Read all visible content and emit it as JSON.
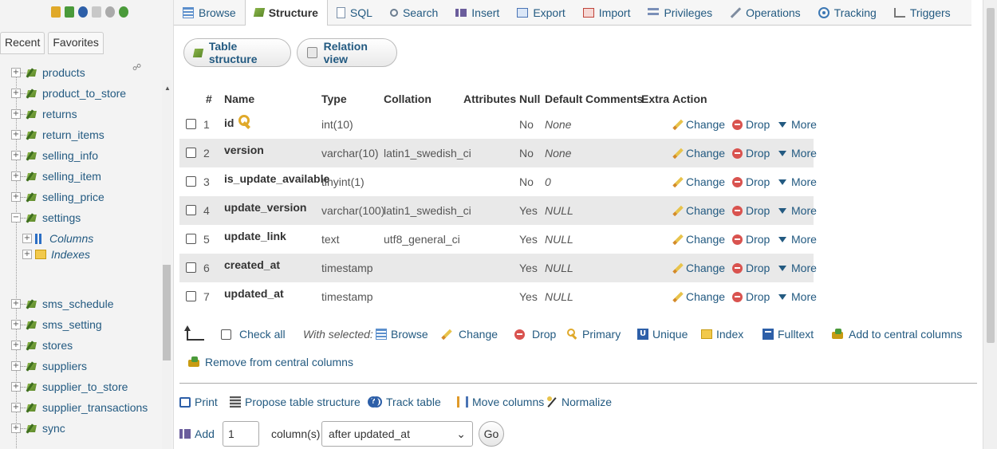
{
  "navigation": {
    "tabs": [
      "Recent",
      "Favorites"
    ],
    "tables_above": [
      {
        "label": "products"
      },
      {
        "label": "product_to_store"
      },
      {
        "label": "returns"
      },
      {
        "label": "return_items"
      },
      {
        "label": "selling_info"
      },
      {
        "label": "selling_item"
      },
      {
        "label": "selling_price"
      },
      {
        "label": "settings"
      }
    ],
    "settings_children": [
      "Columns",
      "Indexes"
    ],
    "tables_below": [
      {
        "label": "sms_schedule"
      },
      {
        "label": "sms_setting"
      },
      {
        "label": "stores"
      },
      {
        "label": "suppliers"
      },
      {
        "label": "supplier_to_store"
      },
      {
        "label": "supplier_transactions"
      },
      {
        "label": "sync"
      }
    ]
  },
  "top_tabs": [
    {
      "label": "Browse",
      "icon": "browse-icon"
    },
    {
      "label": "Structure",
      "icon": "structure-icon",
      "active": true
    },
    {
      "label": "SQL",
      "icon": "sql-icon"
    },
    {
      "label": "Search",
      "icon": "search-icon"
    },
    {
      "label": "Insert",
      "icon": "insert-icon"
    },
    {
      "label": "Export",
      "icon": "export-icon"
    },
    {
      "label": "Import",
      "icon": "import-icon"
    },
    {
      "label": "Privileges",
      "icon": "privileges-icon"
    },
    {
      "label": "Operations",
      "icon": "operations-icon"
    },
    {
      "label": "Tracking",
      "icon": "tracking-icon"
    },
    {
      "label": "Triggers",
      "icon": "triggers-icon"
    }
  ],
  "sub_tabs": {
    "table_structure": "Table structure",
    "relation_view": "Relation view"
  },
  "table": {
    "headers": {
      "num": "#",
      "name": "Name",
      "type": "Type",
      "collation": "Collation",
      "attributes": "Attributes",
      "null": "Null",
      "default": "Default",
      "comments": "Comments",
      "extra": "Extra",
      "action": "Action"
    },
    "rows": [
      {
        "num": "1",
        "name": "id",
        "type": "int(10)",
        "collation": "",
        "null": "No",
        "default": "None",
        "primary": true
      },
      {
        "num": "2",
        "name": "version",
        "type": "varchar(10)",
        "collation": "latin1_swedish_ci",
        "null": "No",
        "default": "None"
      },
      {
        "num": "3",
        "name": "is_update_available",
        "type": "tinyint(1)",
        "collation": "",
        "null": "No",
        "default": "0"
      },
      {
        "num": "4",
        "name": "update_version",
        "type": "varchar(100)",
        "collation": "latin1_swedish_ci",
        "null": "Yes",
        "default": "NULL"
      },
      {
        "num": "5",
        "name": "update_link",
        "type": "text",
        "collation": "utf8_general_ci",
        "null": "Yes",
        "default": "NULL"
      },
      {
        "num": "6",
        "name": "created_at",
        "type": "timestamp",
        "collation": "",
        "null": "Yes",
        "default": "NULL"
      },
      {
        "num": "7",
        "name": "updated_at",
        "type": "timestamp",
        "collation": "",
        "null": "Yes",
        "default": "NULL"
      }
    ],
    "actions": {
      "change": "Change",
      "drop": "Drop",
      "more": "More"
    }
  },
  "bulk": {
    "check_all": "Check all",
    "with_selected": "With selected:",
    "browse": "Browse",
    "change": "Change",
    "drop": "Drop",
    "primary": "Primary",
    "unique": "Unique",
    "index": "Index",
    "fulltext": "Fulltext",
    "add_central": "Add to central columns",
    "remove_central": "Remove from central columns"
  },
  "footer": {
    "print": "Print",
    "propose": "Propose table structure",
    "track": "Track table",
    "move": "Move columns",
    "normalize": "Normalize",
    "add": "Add",
    "add_count": "1",
    "columns_label": "column(s)",
    "position": "after updated_at",
    "go": "Go"
  }
}
